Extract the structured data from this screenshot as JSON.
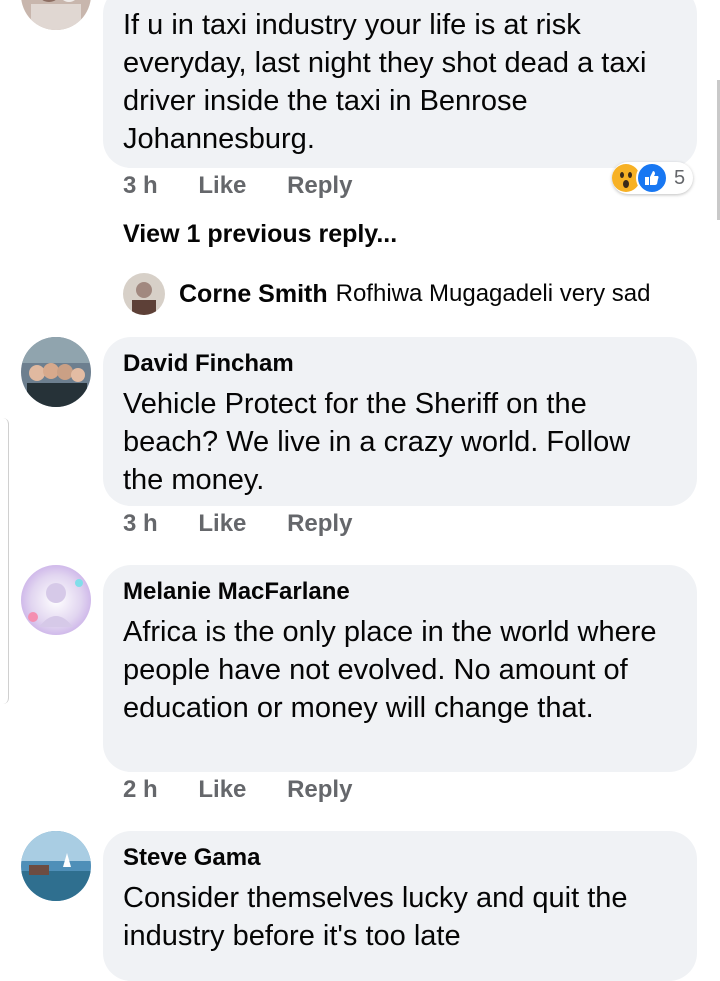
{
  "comments": [
    {
      "text": "If u in taxi industry your life is at risk everyday, last night they shot dead  a taxi driver inside the taxi in Benrose Johannesburg.",
      "time": "3 h",
      "like": "Like",
      "reply": "Reply",
      "reactions": {
        "icons": [
          "wow-icon",
          "like-icon"
        ],
        "count": "5"
      },
      "view_previous": "View 1 previous reply...",
      "reply_preview": {
        "name": "Corne Smith",
        "text": "Rofhiwa Mugagadeli very sad"
      }
    },
    {
      "name": "David Fincham",
      "text": "Vehicle Protect for the Sheriff on the beach?  We live in a crazy world.  Follow the money.",
      "time": "3 h",
      "like": "Like",
      "reply": "Reply"
    },
    {
      "name": "Melanie MacFarlane",
      "text": "Africa is the only place in the world where people have not evolved. No amount of education or money will change that.",
      "time": "2 h",
      "like": "Like",
      "reply": "Reply"
    },
    {
      "name": "Steve Gama",
      "text": "Consider themselves lucky and quit the industry before it's too late"
    }
  ],
  "colors": {
    "bubble": "#f0f2f5",
    "meta": "#65676b",
    "like_blue": "#1877f2",
    "wow_yellow": "#f7b125"
  }
}
